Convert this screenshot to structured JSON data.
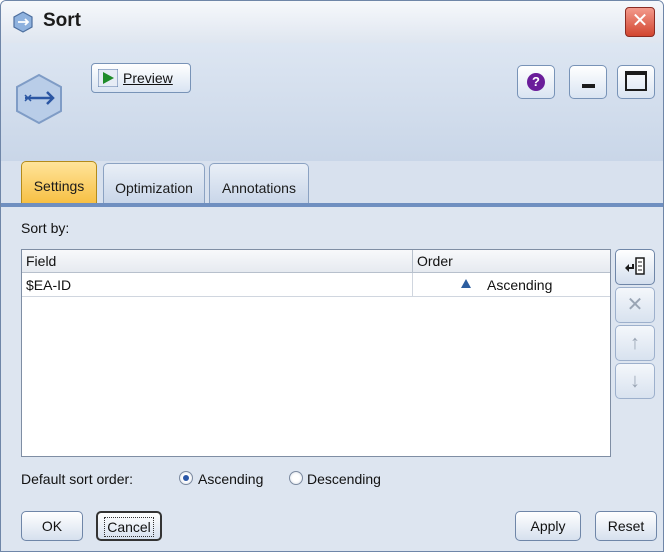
{
  "window": {
    "title": "Sort"
  },
  "toolbar": {
    "preview_label": "Preview"
  },
  "tabs": [
    {
      "label": "Settings",
      "active": true
    },
    {
      "label": "Optimization",
      "active": false
    },
    {
      "label": "Annotations",
      "active": false
    }
  ],
  "settings": {
    "sort_by_label": "Sort by:",
    "table": {
      "headers": [
        "Field",
        "Order"
      ],
      "rows": [
        {
          "field": "$EA-ID",
          "order": "Ascending"
        }
      ]
    },
    "default_sort_order": {
      "label": "Default sort order:",
      "options": [
        "Ascending",
        "Descending"
      ],
      "selected": "Ascending"
    }
  },
  "buttons": {
    "ok": "OK",
    "cancel": "Cancel",
    "apply": "Apply",
    "reset": "Reset"
  },
  "icons": {
    "title": "sort-node-icon",
    "close": "close-icon",
    "help": "help-icon",
    "minimize": "minimize-icon",
    "maximize": "maximize-icon",
    "add_field": "add-field-icon",
    "delete": "delete-icon",
    "move_up": "arrow-up-icon",
    "move_down": "arrow-down-icon"
  },
  "colors": {
    "active_tab": "#f7c044",
    "accent": "#2a57a8",
    "close_button": "#d2452f"
  }
}
